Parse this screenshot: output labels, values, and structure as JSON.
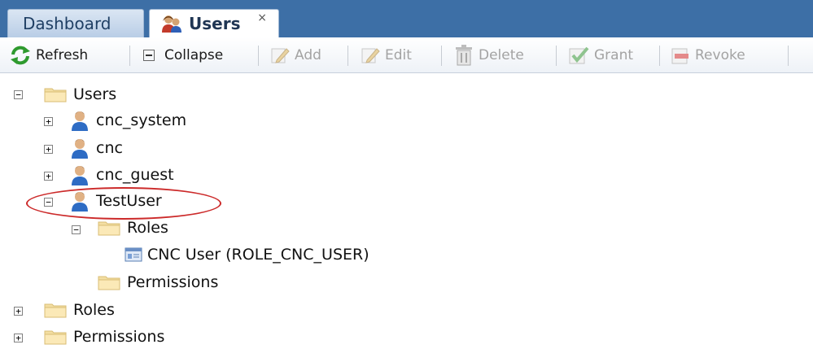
{
  "tabs": [
    {
      "label": "Dashboard",
      "active": false
    },
    {
      "label": "Users",
      "active": true,
      "close": "×"
    }
  ],
  "toolbar": {
    "refresh": "Refresh",
    "collapse": "Collapse",
    "add": "Add",
    "edit": "Edit",
    "delete": "Delete",
    "grant": "Grant",
    "revoke": "Revoke"
  },
  "tree": {
    "users_folder": "Users",
    "users": [
      "cnc_system",
      "cnc",
      "cnc_guest",
      "TestUser"
    ],
    "testuser_roles_folder": "Roles",
    "testuser_role": "CNC User (ROLE_CNC_USER)",
    "testuser_permissions_folder": "Permissions",
    "roles_folder": "Roles",
    "permissions_folder": "Permissions"
  },
  "colors": {
    "tabstrip": "#3d6fa6",
    "highlight": "#cc2a2a"
  }
}
